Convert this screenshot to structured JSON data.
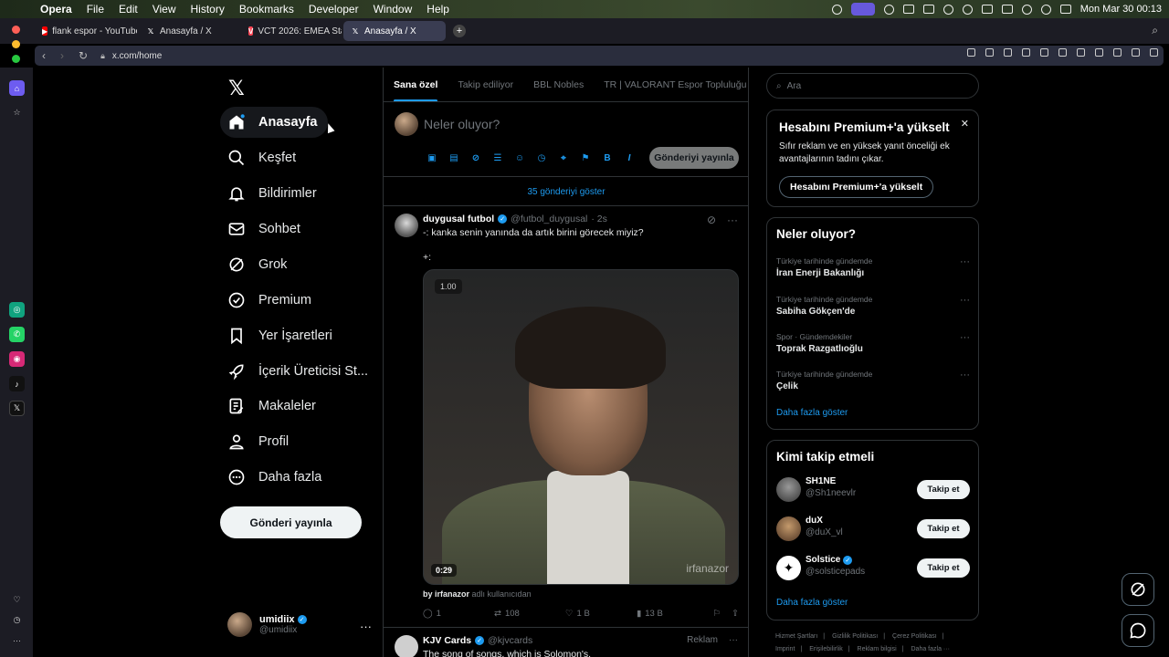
{
  "menubar": {
    "app": "Opera",
    "items": [
      "File",
      "Edit",
      "View",
      "History",
      "Bookmarks",
      "Developer",
      "Window",
      "Help"
    ],
    "datetime": "Mon Mar 30  00:13"
  },
  "tabs": [
    {
      "title": "flank espor - YouTube",
      "icon": "youtube-icon",
      "color": "#ff0000"
    },
    {
      "title": "Anasayfa / X",
      "icon": "x-icon",
      "color": "#000000"
    },
    {
      "title": "VCT 2026: EMEA Stage",
      "icon": "valorant-icon",
      "color": "#ff4655"
    },
    {
      "title": "Anasayfa / X",
      "icon": "x-icon",
      "color": "#000000",
      "active": true
    }
  ],
  "address": {
    "url": "x.com/home"
  },
  "nav": {
    "items": [
      {
        "label": "Anasayfa",
        "icon": "home-icon"
      },
      {
        "label": "Keşfet",
        "icon": "search-icon"
      },
      {
        "label": "Bildirimler",
        "icon": "bell-icon"
      },
      {
        "label": "Sohbet",
        "icon": "mail-icon"
      },
      {
        "label": "Grok",
        "icon": "grok-icon"
      },
      {
        "label": "Premium",
        "icon": "premium-icon"
      },
      {
        "label": "Yer İşaretleri",
        "icon": "bookmark-icon"
      },
      {
        "label": "İçerik Üreticisi St...",
        "icon": "rocket-icon"
      },
      {
        "label": "Makaleler",
        "icon": "article-icon"
      },
      {
        "label": "Profil",
        "icon": "profile-icon"
      },
      {
        "label": "Daha fazla",
        "icon": "more-circle-icon"
      }
    ],
    "post_button": "Gönderi yayınla"
  },
  "me": {
    "name": "umidiix",
    "handle": "@umidiix"
  },
  "feed": {
    "tabs": [
      "Sana özel",
      "Takip ediliyor",
      "BBL Nobles",
      "TR | VALORANT Espor Topluluğu"
    ],
    "compose_placeholder": "Neler oluyor?",
    "publish_label": "Gönderiyi yayınla",
    "show_new": "35 gönderiyi göster",
    "post": {
      "name": "duygusal futbol",
      "handle": "@futbol_duygusal",
      "time": "· 2s",
      "text": "-: kanka senin yanında da artık birini görecek miyiz?",
      "text2": "+:",
      "video_speed": "1.00",
      "video_duration": "0:29",
      "watermark": "irfanazor",
      "by_user": "by irfanazor",
      "by_suffix": "adlı kullanıcıdan",
      "replies": "1",
      "reposts": "108",
      "likes": "1 B",
      "views": "13 B"
    },
    "post2": {
      "name": "KJV Cards",
      "handle": "@kjvcards",
      "ad": "Reklam",
      "text": "The song of songs, which is Solomon's."
    }
  },
  "right": {
    "search_placeholder": "Ara",
    "premium": {
      "title": "Hesabını Premium+'a yükselt",
      "desc": "Sıfır reklam ve en yüksek yanıt önceliği ek avantajlarının tadını çıkar.",
      "button": "Hesabını Premium+'a yükselt"
    },
    "trends": {
      "title": "Neler oluyor?",
      "items": [
        {
          "context": "Türkiye tarihinde gündemde",
          "name": "İran Enerji Bakanlığı"
        },
        {
          "context": "Türkiye tarihinde gündemde",
          "name": "Sabiha Gökçen'de"
        },
        {
          "context": "Spor · Gündemdekiler",
          "name": "Toprak Razgatlıoğlu"
        },
        {
          "context": "Türkiye tarihinde gündemde",
          "name": "Çelik"
        }
      ],
      "more": "Daha fazla göster"
    },
    "follow": {
      "title": "Kimi takip etmeli",
      "items": [
        {
          "name": "SH1NE",
          "handle": "@Sh1neevlr",
          "button": "Takip et"
        },
        {
          "name": "duX",
          "handle": "@duX_vl",
          "button": "Takip et"
        },
        {
          "name": "Solstice",
          "handle": "@solsticepads",
          "button": "Takip et",
          "verified": true
        }
      ],
      "more": "Daha fazla göster"
    },
    "footer": [
      "Hizmet Şartları",
      "|",
      "Gizlilik Politikası",
      "|",
      "Çerez Politikası",
      "|",
      "Imprint",
      "|",
      "Erişilebilirlik",
      "|",
      "Reklam bilgisi",
      "|",
      "Daha fazla ···"
    ]
  }
}
